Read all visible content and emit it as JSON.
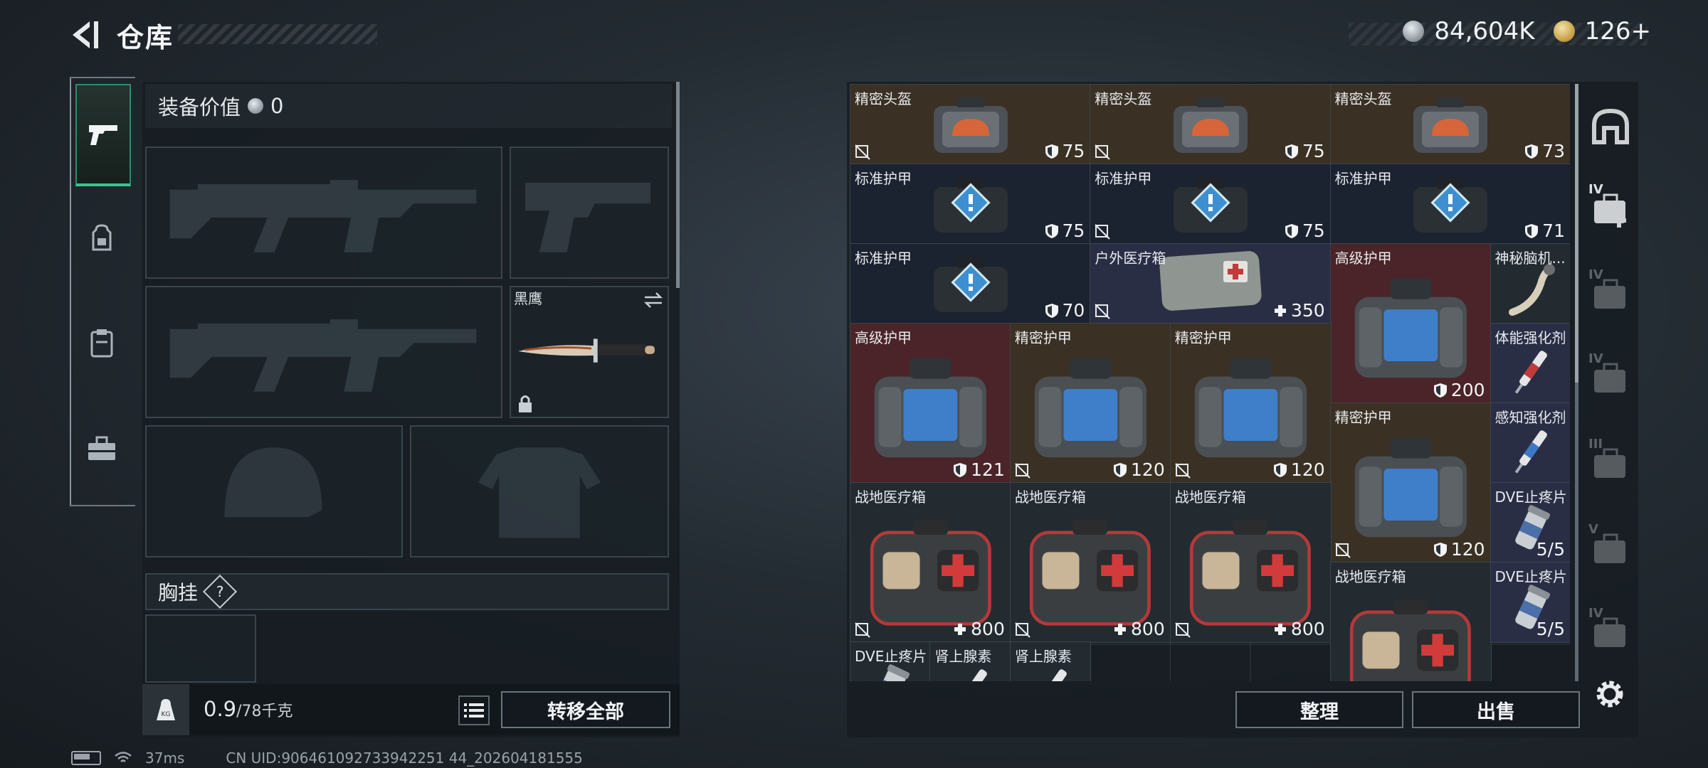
{
  "header": {
    "title": "仓库",
    "currency": [
      {
        "icon": "silver-coin-icon",
        "value": "84,604K"
      },
      {
        "icon": "gold-coin-icon",
        "value": "126+"
      }
    ]
  },
  "left_tabs": [
    {
      "icon": "pistol-icon",
      "active": true
    },
    {
      "icon": "backpack-icon",
      "active": false
    },
    {
      "icon": "vest-icon",
      "active": false
    },
    {
      "icon": "toolbox-icon",
      "active": false
    }
  ],
  "equipment": {
    "value_label": "装备价值",
    "value": "0",
    "melee_label": "黑鹰",
    "chest_label": "胸挂",
    "chest_help": "?"
  },
  "footer": {
    "weight_current": "0.9",
    "weight_max": "/78千克",
    "transfer_all": "转移全部"
  },
  "inventory": {
    "items": [
      {
        "name": "精密头盔",
        "value": "75",
        "type": "helmet-bag",
        "bg": "brown",
        "no_save": true
      },
      {
        "name": "精密头盔",
        "value": "75",
        "type": "helmet-bag",
        "bg": "brown",
        "no_save": true
      },
      {
        "name": "精密头盔",
        "value": "73",
        "type": "helmet-bag",
        "bg": "brown",
        "no_save": false
      },
      {
        "name": "标准护甲",
        "value": "75",
        "type": "std-armor",
        "bg": "navy",
        "no_save": false
      },
      {
        "name": "标准护甲",
        "value": "75",
        "type": "std-armor",
        "bg": "navy",
        "no_save": true
      },
      {
        "name": "标准护甲",
        "value": "71",
        "type": "std-armor",
        "bg": "navy",
        "no_save": false
      },
      {
        "name": "标准护甲",
        "value": "70",
        "type": "std-armor",
        "bg": "navy",
        "no_save": false
      },
      {
        "name": "户外医疗箱",
        "value": "350",
        "type": "outdoor-med",
        "bg": "blue",
        "no_save": true
      },
      {
        "name": "高级护甲",
        "value": "200",
        "type": "armor-bag",
        "bg": "red",
        "no_save": false
      },
      {
        "name": "神秘脑机...",
        "value": "",
        "type": "horn",
        "bg": "dark",
        "no_save": false
      },
      {
        "name": "高级护甲",
        "value": "121",
        "type": "armor-bag",
        "bg": "red",
        "no_save": false
      },
      {
        "name": "精密护甲",
        "value": "120",
        "type": "armor-bag",
        "bg": "brown",
        "no_save": true
      },
      {
        "name": "精密护甲",
        "value": "120",
        "type": "armor-bag",
        "bg": "brown",
        "no_save": true
      },
      {
        "name": "体能强化剂",
        "value": "",
        "type": "syringe-red",
        "bg": "blue",
        "no_save": false
      },
      {
        "name": "精密护甲",
        "value": "120",
        "type": "armor-bag",
        "bg": "brown",
        "no_save": true
      },
      {
        "name": "感知强化剂",
        "value": "",
        "type": "syringe-blue",
        "bg": "blue",
        "no_save": false
      },
      {
        "name": "战地医疗箱",
        "value": "800",
        "type": "firstaid",
        "bg": "dark",
        "no_save": true
      },
      {
        "name": "战地医疗箱",
        "value": "800",
        "type": "firstaid",
        "bg": "dark",
        "no_save": true
      },
      {
        "name": "战地医疗箱",
        "value": "800",
        "type": "firstaid",
        "bg": "dark",
        "no_save": true
      },
      {
        "name": "DVE止疼片",
        "value": "5/5",
        "type": "pills",
        "bg": "blue",
        "no_save": false
      },
      {
        "name": "战地医疗箱",
        "value": "",
        "type": "firstaid",
        "bg": "dark",
        "no_save": false
      },
      {
        "name": "DVE止疼片",
        "value": "5/5",
        "type": "pills",
        "bg": "blue",
        "no_save": false
      },
      {
        "name": "DVE止疼片",
        "value": "",
        "type": "pills",
        "bg": "dark",
        "no_save": false
      },
      {
        "name": "肾上腺素",
        "value": "",
        "type": "syringe-green",
        "bg": "dark",
        "no_save": false
      },
      {
        "name": "肾上腺素",
        "value": "",
        "type": "syringe-green",
        "bg": "dark",
        "no_save": false
      }
    ],
    "sort_button": "整理",
    "sell_button": "出售"
  },
  "right_sidebar": [
    {
      "icon": "arch-icon"
    },
    {
      "icon": "medkit-plus-icon",
      "tier": "IV"
    },
    {
      "icon": "ammo-icon",
      "tier": "IV"
    },
    {
      "icon": "gear-item-icon",
      "tier": "IV"
    },
    {
      "icon": "triangle-item-icon",
      "tier": "III"
    },
    {
      "icon": "gear-item-icon",
      "tier": "V"
    },
    {
      "icon": "gear-item-icon",
      "tier": "IV"
    }
  ],
  "status_bar": {
    "ping": "37ms",
    "uid": "CN UID:906461092733942251 44_202604181555"
  },
  "colors": {
    "accent_green": "#3cc48f",
    "brown_bg": "#3a3024",
    "red_bg": "#4a2428",
    "navy_bg": "#1b2230"
  }
}
